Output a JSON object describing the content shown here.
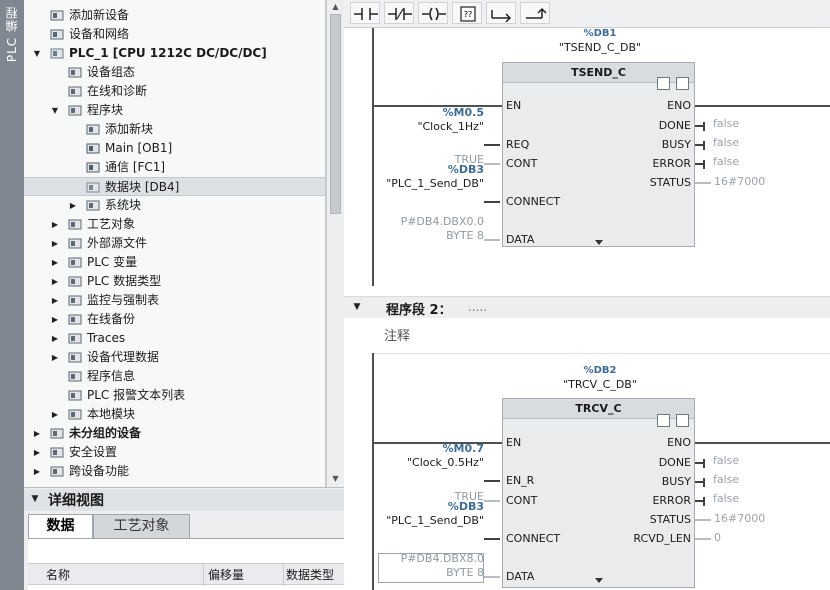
{
  "sidebar": {
    "vertical_tab": "PLC 编程"
  },
  "tree": {
    "items": [
      {
        "label": "添加新设备",
        "indent": 0,
        "expander": "",
        "icon": "add-device-icon",
        "bold": false,
        "selected": false
      },
      {
        "label": "设备和网络",
        "indent": 0,
        "expander": "",
        "icon": "network-icon",
        "bold": false,
        "selected": false
      },
      {
        "label": "PLC_1 [CPU 1212C DC/DC/DC]",
        "indent": 0,
        "expander": "down",
        "icon": "plc-icon",
        "bold": true,
        "selected": false
      },
      {
        "label": "设备组态",
        "indent": 1,
        "expander": "",
        "icon": "device-config-icon",
        "bold": false,
        "selected": false
      },
      {
        "label": "在线和诊断",
        "indent": 1,
        "expander": "",
        "icon": "online-diagnostics-icon",
        "bold": false,
        "selected": false
      },
      {
        "label": "程序块",
        "indent": 1,
        "expander": "down",
        "icon": "program-blocks-icon",
        "bold": false,
        "selected": false
      },
      {
        "label": "添加新块",
        "indent": 2,
        "expander": "",
        "icon": "add-block-icon",
        "bold": false,
        "selected": false
      },
      {
        "label": "Main [OB1]",
        "indent": 2,
        "expander": "",
        "icon": "ob-block-icon",
        "bold": false,
        "selected": false
      },
      {
        "label": "通信 [FC1]",
        "indent": 2,
        "expander": "",
        "icon": "fc-block-icon",
        "bold": false,
        "selected": false
      },
      {
        "label": "数据块 [DB4]",
        "indent": 2,
        "expander": "",
        "icon": "db-block-icon",
        "bold": false,
        "selected": true
      },
      {
        "label": "系统块",
        "indent": 2,
        "expander": "right",
        "icon": "system-blocks-icon",
        "bold": false,
        "selected": false
      },
      {
        "label": "工艺对象",
        "indent": 1,
        "expander": "right",
        "icon": "technology-objects-icon",
        "bold": false,
        "selected": false
      },
      {
        "label": "外部源文件",
        "indent": 1,
        "expander": "right",
        "icon": "external-source-icon",
        "bold": false,
        "selected": false
      },
      {
        "label": "PLC 变量",
        "indent": 1,
        "expander": "right",
        "icon": "plc-tags-icon",
        "bold": false,
        "selected": false
      },
      {
        "label": "PLC 数据类型",
        "indent": 1,
        "expander": "right",
        "icon": "plc-data-types-icon",
        "bold": false,
        "selected": false
      },
      {
        "label": "监控与强制表",
        "indent": 1,
        "expander": "right",
        "icon": "watch-table-icon",
        "bold": false,
        "selected": false
      },
      {
        "label": "在线备份",
        "indent": 1,
        "expander": "right",
        "icon": "online-backup-icon",
        "bold": false,
        "selected": false
      },
      {
        "label": "Traces",
        "indent": 1,
        "expander": "right",
        "icon": "traces-icon",
        "bold": false,
        "selected": false
      },
      {
        "label": "设备代理数据",
        "indent": 1,
        "expander": "right",
        "icon": "proxy-data-icon",
        "bold": false,
        "selected": false
      },
      {
        "label": "程序信息",
        "indent": 1,
        "expander": "",
        "icon": "program-info-icon",
        "bold": false,
        "selected": false
      },
      {
        "label": "PLC 报警文本列表",
        "indent": 1,
        "expander": "",
        "icon": "alarm-text-icon",
        "bold": false,
        "selected": false
      },
      {
        "label": "本地模块",
        "indent": 1,
        "expander": "right",
        "icon": "local-modules-icon",
        "bold": false,
        "selected": false
      },
      {
        "label": "未分组的设备",
        "indent": 0,
        "expander": "right",
        "icon": "ungrouped-devices-icon",
        "bold": true,
        "selected": false
      },
      {
        "label": "安全设置",
        "indent": 0,
        "expander": "right",
        "icon": "security-icon",
        "bold": false,
        "selected": false
      },
      {
        "label": "跨设备功能",
        "indent": 0,
        "expander": "right",
        "icon": "cross-device-icon",
        "bold": false,
        "selected": false
      }
    ]
  },
  "detail": {
    "title": "详细视图",
    "tabs": [
      "数据",
      "工艺对象"
    ],
    "columns": [
      "名称",
      "偏移量",
      "数据类型"
    ]
  },
  "toolbar": {
    "buttons": [
      "no-contact-icon",
      "nc-contact-icon",
      "coil-icon",
      "empty-box-icon",
      "open-branch-icon",
      "close-branch-icon"
    ]
  },
  "network1": {
    "db_number": "%DB1",
    "db_name": "\"TSEND_C_DB\"",
    "block_title": "TSEND_C",
    "inputs": [
      {
        "pin": "EN",
        "addr": "",
        "value": "",
        "dim": false
      },
      {
        "pin": "REQ",
        "addr": "%M0.5",
        "value": "\"Clock_1Hz\"",
        "dim": false
      },
      {
        "pin": "CONT",
        "addr": "",
        "value": "TRUE",
        "dim": true
      },
      {
        "pin": "CONNECT",
        "addr": "%DB3",
        "value": "\"PLC_1_Send_DB\"",
        "dim": false
      },
      {
        "pin": "DATA",
        "addr": "P#DB4.DBX0.0",
        "value": "BYTE 8",
        "dim": true
      }
    ],
    "outputs": [
      {
        "pin": "ENO",
        "value": ""
      },
      {
        "pin": "DONE",
        "value": "false"
      },
      {
        "pin": "BUSY",
        "value": "false"
      },
      {
        "pin": "ERROR",
        "value": "false"
      },
      {
        "pin": "STATUS",
        "value": "16#7000"
      }
    ]
  },
  "segment2": {
    "title": "程序段 2：",
    "dots": ".....",
    "comment": "注释"
  },
  "network2": {
    "db_number": "%DB2",
    "db_name": "\"TRCV_C_DB\"",
    "block_title": "TRCV_C",
    "inputs": [
      {
        "pin": "EN",
        "addr": "",
        "value": "",
        "dim": false
      },
      {
        "pin": "EN_R",
        "addr": "%M0.7",
        "value": "\"Clock_0.5Hz\"",
        "dim": false
      },
      {
        "pin": "CONT",
        "addr": "",
        "value": "TRUE",
        "dim": true
      },
      {
        "pin": "CONNECT",
        "addr": "%DB3",
        "value": "\"PLC_1_Send_DB\"",
        "dim": false
      },
      {
        "pin": "DATA",
        "addr": "P#DB4.DBX8.0",
        "value": "BYTE 8",
        "dim": true
      }
    ],
    "outputs": [
      {
        "pin": "ENO",
        "value": ""
      },
      {
        "pin": "DONE",
        "value": "false"
      },
      {
        "pin": "BUSY",
        "value": "false"
      },
      {
        "pin": "ERROR",
        "value": "false"
      },
      {
        "pin": "STATUS",
        "value": "16#7000"
      },
      {
        "pin": "RCVD_LEN",
        "value": "0"
      }
    ]
  }
}
